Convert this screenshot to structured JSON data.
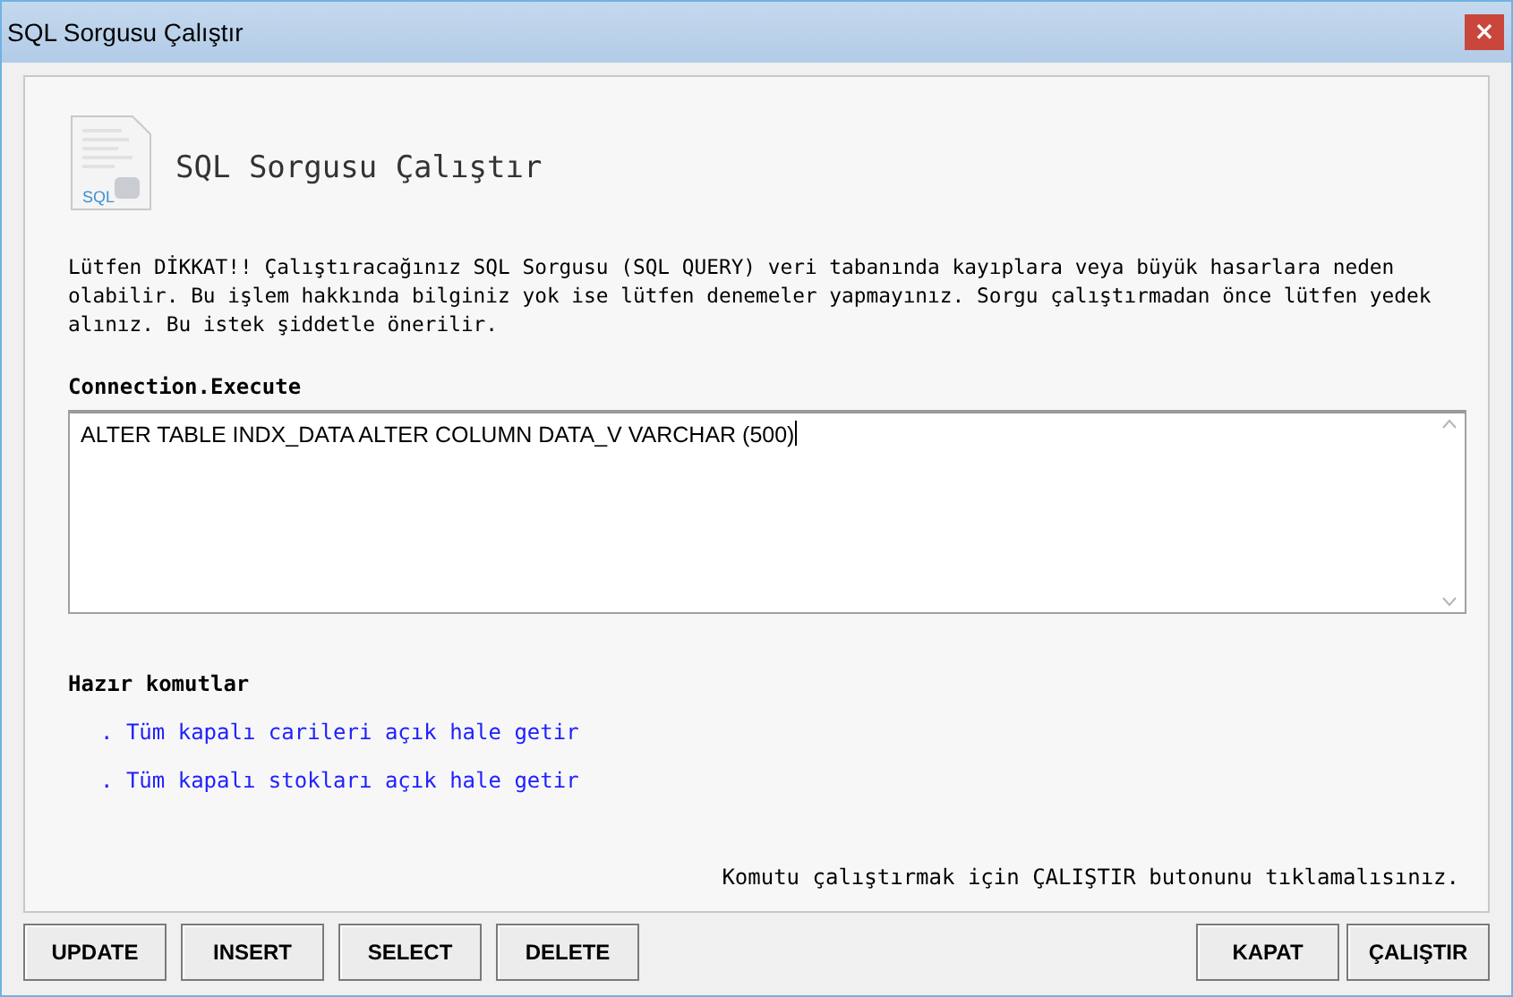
{
  "window": {
    "title": "SQL Sorgusu Çalıştır",
    "close": "×"
  },
  "header": {
    "title": "SQL Sorgusu Çalıştır",
    "icon_label": "SQL"
  },
  "warning": "Lütfen DİKKAT!! Çalıştıracağınız SQL Sorgusu (SQL QUERY) veri tabanında kayıplara veya büyük hasarlara neden olabilir. Bu işlem hakkında bilginiz yok ise lütfen denemeler yapmayınız. Sorgu çalıştırmadan önce lütfen yedek alınız. Bu istek şiddetle önerilir.",
  "query": {
    "label": "Connection.Execute",
    "value": "ALTER TABLE INDX_DATA ALTER COLUMN DATA_V VARCHAR (500)"
  },
  "presets": {
    "label": "Hazır komutlar",
    "items": [
      {
        "text": ". Tüm kapalı carileri açık hale getir"
      },
      {
        "text": ". Tüm kapalı stokları açık hale getir"
      }
    ]
  },
  "hint": "Komutu çalıştırmak için ÇALIŞTIR butonunu tıklamalısınız.",
  "left_buttons": [
    "UPDATE",
    "INSERT",
    "SELECT",
    "DELETE"
  ],
  "right_buttons": [
    "KAPAT",
    "ÇALIŞTIR"
  ]
}
